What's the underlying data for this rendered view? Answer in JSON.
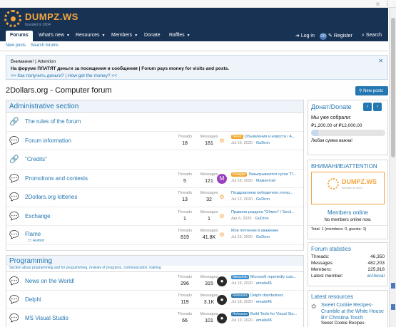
{
  "site": {
    "logo_name": "DUMPZ.WS",
    "logo_sub": "founded in 2004"
  },
  "nav": {
    "tabs": [
      {
        "label": "Forums",
        "active": true
      },
      {
        "label": "What's new",
        "caret": true
      },
      {
        "label": "Resources",
        "caret": true
      },
      {
        "label": "Members",
        "caret": true
      },
      {
        "label": "Donate"
      },
      {
        "label": "Raffles",
        "caret": true
      }
    ],
    "login": "Log in",
    "or": "OR",
    "register": "Register",
    "search": "Search"
  },
  "subnav": {
    "new_posts": "New posts",
    "search_forums": "Search forums"
  },
  "notice": {
    "line1": "Внимание! | Attention",
    "line2": "На форуме ПЛАТЯТ деньги за посещения и сообщения | Forum pays money for visits and posts.",
    "line3": ">> Как получить деньги? | How get the money? <<"
  },
  "page_title": "2Dollars.org - Computer forum",
  "new_posts_button": "New posts",
  "stat_labels": {
    "threads": "Threads",
    "messages": "Messages"
  },
  "admin": {
    "title": "Administrative section",
    "rows": [
      {
        "name": "The rules of the forum"
      },
      {
        "name": "Forum information",
        "threads": "18",
        "messages": "181",
        "badge": "News",
        "badge_color": "#f0a526",
        "last": "Объявления и новости / A...",
        "date": "Jul 16, 2020",
        "user": "GuDron",
        "av_color": "#f2a33a"
      },
      {
        "name": "\"Credits\""
      },
      {
        "name": "Promotions and contests",
        "threads": "5",
        "messages": "121",
        "badge": "Конкурс",
        "badge_color": "#f0a526",
        "last": "Разыгрываются сутки \"П...",
        "date": "Jul 18, 2020",
        "user": "Мамонтов!",
        "av_color": "#9b3fbf",
        "av_letter": "M"
      },
      {
        "name": "2Dollars.org lotteries",
        "threads": "13",
        "messages": "32",
        "last": "Поздравляем победителя лотер...",
        "date": "Jul 12, 2020",
        "user": "GuDron",
        "av_color": "#f2a33a"
      },
      {
        "name": "Exchange",
        "threads": "1",
        "messages": "1",
        "last": "Правила раздела \"Обмен\" / Secti...",
        "date": "Apr 6, 2020",
        "user": "GuDron",
        "av_color": "#f2a33a"
      },
      {
        "name": "Flame",
        "sub": "Humor",
        "threads": "819",
        "messages": "41.8K",
        "last": "Мое почтение в уважение",
        "date": "Jul 19, 2020",
        "user": "GuDron",
        "av_color": "#f2a33a"
      }
    ]
  },
  "programming": {
    "title": "Programming",
    "desc": "Section about programming and for programming, reviews of programs, communication, training",
    "rows": [
      {
        "name": "News on the World!",
        "threads": "296",
        "messages": "315",
        "badge": "NewsInfo",
        "badge_color": "#3c8fd1",
        "last": "Microsoft reportedly cuts...",
        "date": "Jul 19, 2020",
        "user": "emails45",
        "av_color": "#2a2a2a"
      },
      {
        "name": "Delphi",
        "threads": "119",
        "messages": "3.1K",
        "badge": "Releases",
        "badge_color": "#2577b1",
        "last": "Delphi distributives",
        "date": "Jul 18, 2020",
        "user": "emails45",
        "av_color": "#2a2a2a"
      },
      {
        "name": "MS Visual Studio",
        "threads": "66",
        "messages": "101",
        "badge": "Releases",
        "badge_color": "#2577b1",
        "last": "Build Tools for Visual Stu...",
        "date": "Jul 19, 2020",
        "user": "emails45",
        "av_color": "#2a2a2a"
      }
    ]
  },
  "donate": {
    "title": "Донат/Donate",
    "collected_label": "Мы уже собрали:",
    "amount": "₽1,200.00 of ₽12,000.00",
    "progress": 0.1,
    "note": "Любая сумма важна!"
  },
  "attention": {
    "title": "ВНИМАНИЕ/ATTENTION",
    "logo": "DUMPZ.WS",
    "logo_sub": "founded in 2004"
  },
  "online": {
    "title": "Members online",
    "text": "No members online now.",
    "total": "Total: 1 (members: 0, guests: 1)"
  },
  "stats": {
    "title": "Forum statistics",
    "rows": [
      {
        "label": "Threads:",
        "value": "46,350"
      },
      {
        "label": "Messages:",
        "value": "482,203"
      },
      {
        "label": "Members:",
        "value": "225,918"
      },
      {
        "label": "Latest member:",
        "value": "archeval"
      }
    ]
  },
  "resources": {
    "title": "Latest resources",
    "item": "Sweet Cookie Recipes- Crumble at the White House",
    "by": "BY Christina Tosch",
    "more": "Sweet Cookie Recipes-"
  }
}
